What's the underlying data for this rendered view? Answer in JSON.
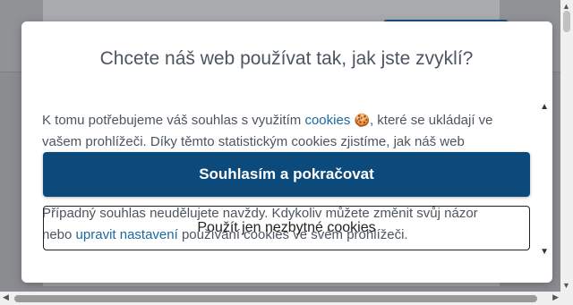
{
  "modal": {
    "title": "Chcete náš web používat tak, jak jste zvyklí?",
    "body_prefix": "K tomu potřebujeme váš souhlas s využitím ",
    "body_link": "cookies",
    "body_emoji": "🍪",
    "body_suffix": ", které se ukládají ve vašem prohlížeči. Díky těmto statistickým cookies zjistíme, jak náš web",
    "accept_label": "Souhlasím a pokračovat",
    "necessary_label": "Použít jen nezbytné cookies",
    "body2_prefix": "Případný souhlas neudělujete navždy. Kdykoliv můžete změnit svůj názor nebo ",
    "body2_link": "upravit nastavení",
    "body2_suffix": " používání cookies ve svém prohlížeči."
  },
  "icons": {
    "modal_scroll_up": "▲",
    "modal_scroll_down": "▼",
    "page_scroll_up": "▲",
    "page_scroll_down": "▼",
    "page_scroll_left": "◀",
    "page_scroll_right": "▶"
  }
}
